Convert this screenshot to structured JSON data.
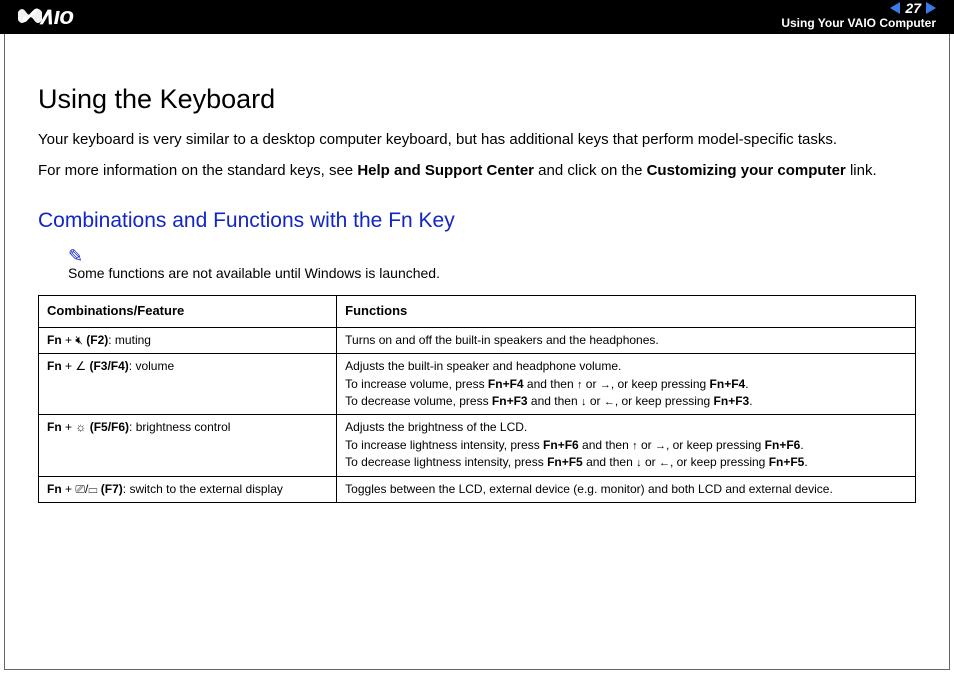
{
  "header": {
    "page_number": "27",
    "breadcrumb": "Using Your VAIO Computer"
  },
  "title": "Using the Keyboard",
  "p1_a": "Your keyboard is very similar to a desktop computer keyboard, but has additional keys that perform model-specific tasks.",
  "p2_a": "For more information on the standard keys, see ",
  "p2_b": "Help and Support Center",
  "p2_c": " and click on the ",
  "p2_d": "Customizing your computer",
  "p2_e": " link.",
  "h2": "Combinations and Functions with the Fn Key",
  "note": "Some functions are not available until Windows is launched.",
  "th1": "Combinations/Feature",
  "th2": "Functions",
  "r1_fn": "Fn",
  "r1_plus": " + ",
  "r1_key": " (F2)",
  "r1_desc": ": muting",
  "r1_func": "Turns on and off the built-in speakers and the headphones.",
  "r2_fn": "Fn",
  "r2_plus": " + ",
  "r2_key": " (F3/F4)",
  "r2_desc": ": volume",
  "r2_l1": "Adjusts the built-in speaker and headphone volume.",
  "r2_l2a": "To increase volume, press ",
  "r2_l2b": "Fn+F4",
  "r2_l2c": " and then ",
  "r2_l2d": " or ",
  "r2_l2e": ", or keep pressing ",
  "r2_l2f": "Fn+F4",
  "r2_l3a": "To decrease volume, press ",
  "r2_l3b": "Fn+F3",
  "r2_l3c": " and then ",
  "r2_l3d": " or ",
  "r2_l3e": ", or keep pressing ",
  "r2_l3f": "Fn+F3",
  "r3_fn": "Fn",
  "r3_plus": " + ",
  "r3_key": " (F5/F6)",
  "r3_desc": ": brightness control",
  "r3_l1": "Adjusts the brightness of the LCD.",
  "r3_l2a": "To increase lightness intensity, press ",
  "r3_l2b": "Fn+F6",
  "r3_l2c": " and then ",
  "r3_l2d": " or ",
  "r3_l2e": ", or keep pressing ",
  "r3_l2f": "Fn+F6",
  "r3_l3a": "To decrease lightness intensity, press ",
  "r3_l3b": "Fn+F5",
  "r3_l3c": " and then ",
  "r3_l3d": " or ",
  "r3_l3e": ", or keep pressing ",
  "r3_l3f": "Fn+F5",
  "r4_fn": "Fn",
  "r4_plus": " + ",
  "r4_key": " (F7)",
  "r4_desc": ": switch to the external display",
  "r4_func": "Toggles between the LCD, external device (e.g. monitor) and both LCD and external device."
}
